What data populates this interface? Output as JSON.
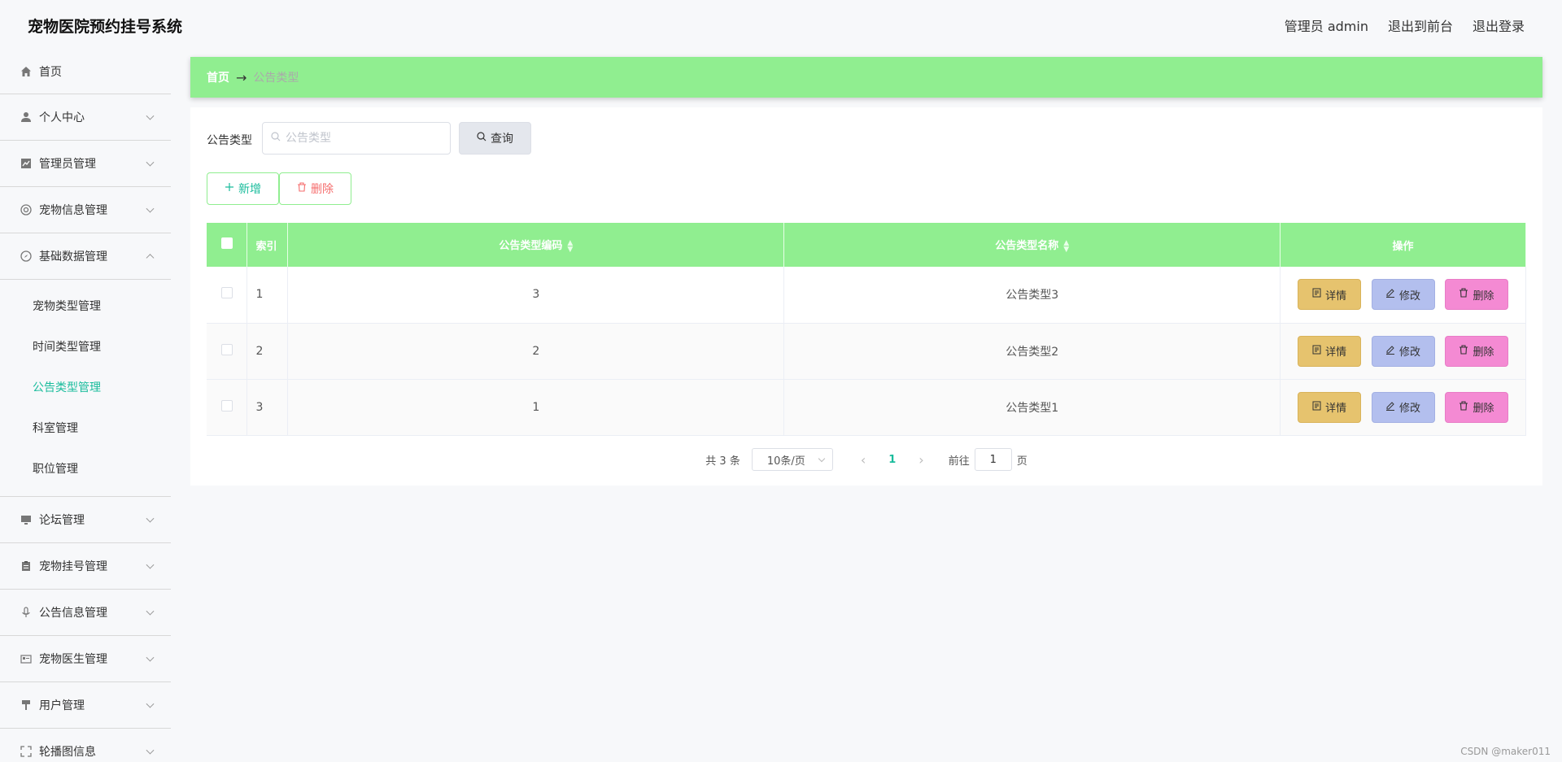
{
  "header": {
    "title": "宠物医院预约挂号系统",
    "user_label": "管理员 admin",
    "exit_front": "退出到前台",
    "logout": "退出登录"
  },
  "sidebar": {
    "items": [
      {
        "label": "首页",
        "icon": "home-icon"
      },
      {
        "label": "个人中心",
        "icon": "user-icon"
      },
      {
        "label": "管理员管理",
        "icon": "chart-icon"
      },
      {
        "label": "宠物信息管理",
        "icon": "lifebuoy-icon"
      },
      {
        "label": "基础数据管理",
        "icon": "compass-icon"
      },
      {
        "label": "论坛管理",
        "icon": "monitor-icon"
      },
      {
        "label": "宠物挂号管理",
        "icon": "clipboard-icon"
      },
      {
        "label": "公告信息管理",
        "icon": "microphone-icon"
      },
      {
        "label": "宠物医生管理",
        "icon": "id-card-icon"
      },
      {
        "label": "用户管理",
        "icon": "brush-icon"
      },
      {
        "label": "轮播图信息",
        "icon": "fullscreen-icon"
      }
    ],
    "sub_items": [
      "宠物类型管理",
      "时间类型管理",
      "公告类型管理",
      "科室管理",
      "职位管理"
    ],
    "active_sub": "公告类型管理"
  },
  "breadcrumb": {
    "home": "首页",
    "arrow": "→",
    "current": "公告类型"
  },
  "search": {
    "label": "公告类型",
    "placeholder": "公告类型",
    "value": "",
    "query_label": "查询"
  },
  "toolbar": {
    "add_label": "新增",
    "delete_label": "删除"
  },
  "table": {
    "headers": {
      "index": "索引",
      "code": "公告类型编码",
      "name": "公告类型名称",
      "actions": "操作"
    },
    "rows": [
      {
        "index": "1",
        "code": "3",
        "name": "公告类型3"
      },
      {
        "index": "2",
        "code": "2",
        "name": "公告类型2"
      },
      {
        "index": "3",
        "code": "1",
        "name": "公告类型1"
      }
    ],
    "actions": {
      "detail": "详情",
      "edit": "修改",
      "delete": "删除"
    }
  },
  "pagination": {
    "total": "共 3 条",
    "page_size": "10条/页",
    "current_page": "1",
    "goto_label": "前往",
    "goto_value": "1",
    "page_suffix": "页"
  },
  "watermark": "CSDN @maker011",
  "colors": {
    "accent_green": "#90ee90",
    "active_text": "#1abc9c",
    "detail_btn": "#e6c36e",
    "edit_btn": "#b3bfee",
    "delete_btn": "#f48ad3"
  }
}
